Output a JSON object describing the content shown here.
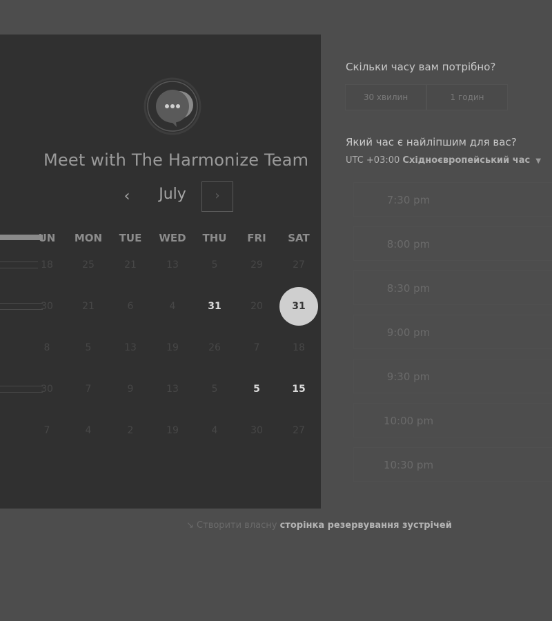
{
  "calendar": {
    "title": "Meet with The Harmonize Team",
    "month": "July",
    "prev_icon": "‹",
    "next_icon": "›",
    "weekdays": [
      "UN",
      "MON",
      "TUE",
      "WED",
      "THU",
      "FRI",
      "SAT"
    ],
    "weeks": [
      [
        "18",
        "25",
        "21",
        "13",
        "5",
        "29",
        "27"
      ],
      [
        "30",
        "21",
        "6",
        "4",
        "31",
        "20",
        "31"
      ],
      [
        "8",
        "5",
        "13",
        "19",
        "26",
        "7",
        "18"
      ],
      [
        "30",
        "7",
        "9",
        "13",
        "5",
        "5",
        "15"
      ],
      [
        "7",
        "4",
        "2",
        "19",
        "4",
        "30",
        "27"
      ]
    ],
    "selected_day": "31"
  },
  "duration": {
    "question": "Скільки часу вам потрібно?",
    "options": [
      "30 хвилин",
      "1 годин"
    ]
  },
  "time": {
    "question": "Який час є найліпшим для вас?",
    "tz_offset": "UTC +03:00",
    "tz_name": "Східноєвропейський час",
    "slots": [
      "7:30 pm",
      "8:00 pm",
      "8:30 pm",
      "9:00 pm",
      "9:30 pm",
      "10:00 pm",
      "10:30 pm"
    ]
  },
  "footer": {
    "prefix": "Створити власну",
    "link": "сторінка резервування зустрічей"
  },
  "colors": {
    "background": "#4d4d4d",
    "panel": "#303030",
    "selected": "#cfcfcf"
  }
}
